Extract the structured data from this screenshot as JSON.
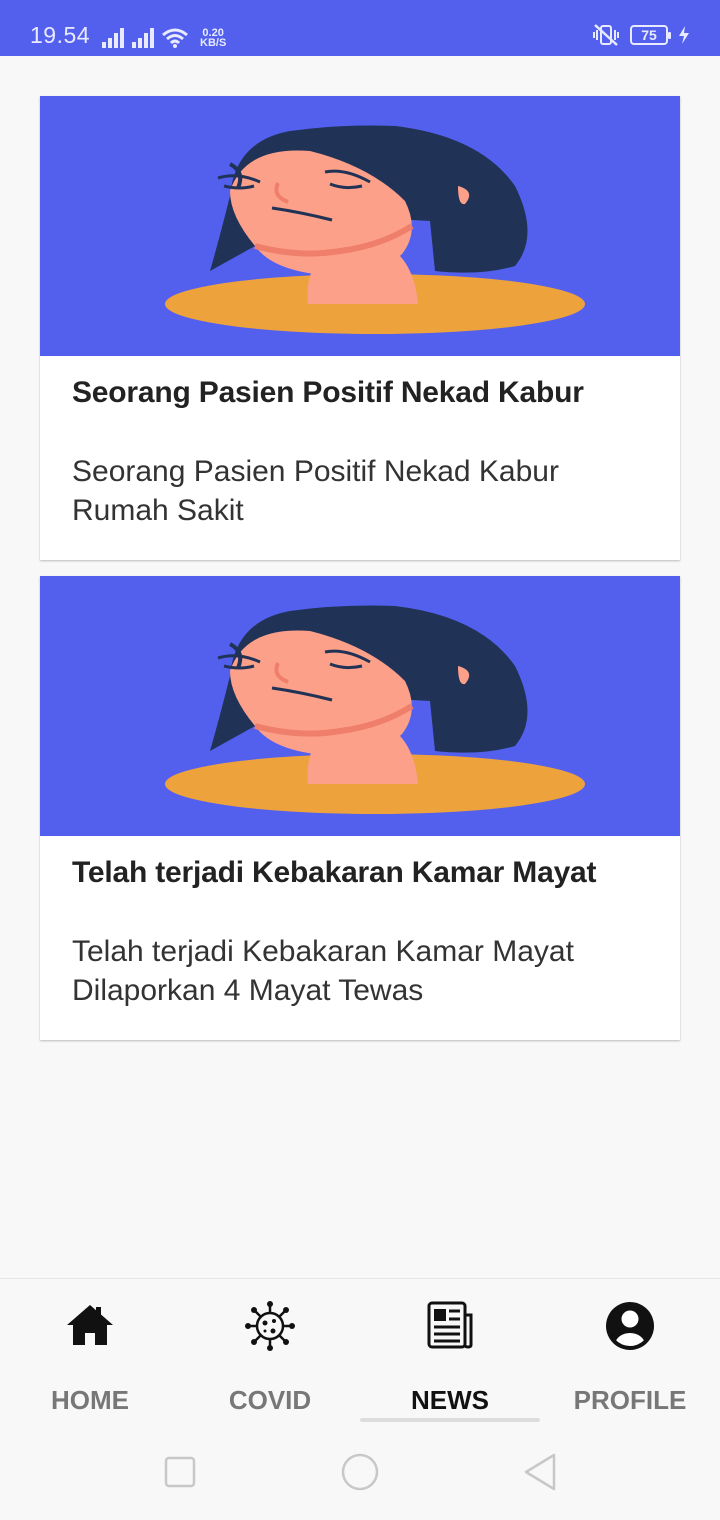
{
  "status_bar": {
    "time": "19.54",
    "net_speed_value": "0.20",
    "net_speed_unit": "KB/S",
    "battery": "75",
    "icons": [
      "signal-icon",
      "signal-icon",
      "wifi-icon",
      "vibrate-icon",
      "battery-icon",
      "charging-icon"
    ]
  },
  "news": [
    {
      "title": "Seorang Pasien Positif Nekad Kabur",
      "description": "Seorang Pasien Positif Nekad Kabur Rumah Sakit"
    },
    {
      "title": "Telah terjadi Kebakaran Kamar Mayat",
      "description": "Telah terjadi Kebakaran Kamar Mayat Dilaporkan 4 Mayat Tewas"
    }
  ],
  "bottom_nav": {
    "items": [
      {
        "label": "HOME",
        "icon": "home-icon"
      },
      {
        "label": "COVID",
        "icon": "virus-icon"
      },
      {
        "label": "NEWS",
        "icon": "newspaper-icon"
      },
      {
        "label": "PROFILE",
        "icon": "account-circle-icon"
      }
    ],
    "active": "NEWS"
  },
  "colors": {
    "primary": "#5360ee",
    "hair": "#203356",
    "skin": "#fca08a",
    "shirt": "#eea23b",
    "background": "#f8f8f8"
  }
}
